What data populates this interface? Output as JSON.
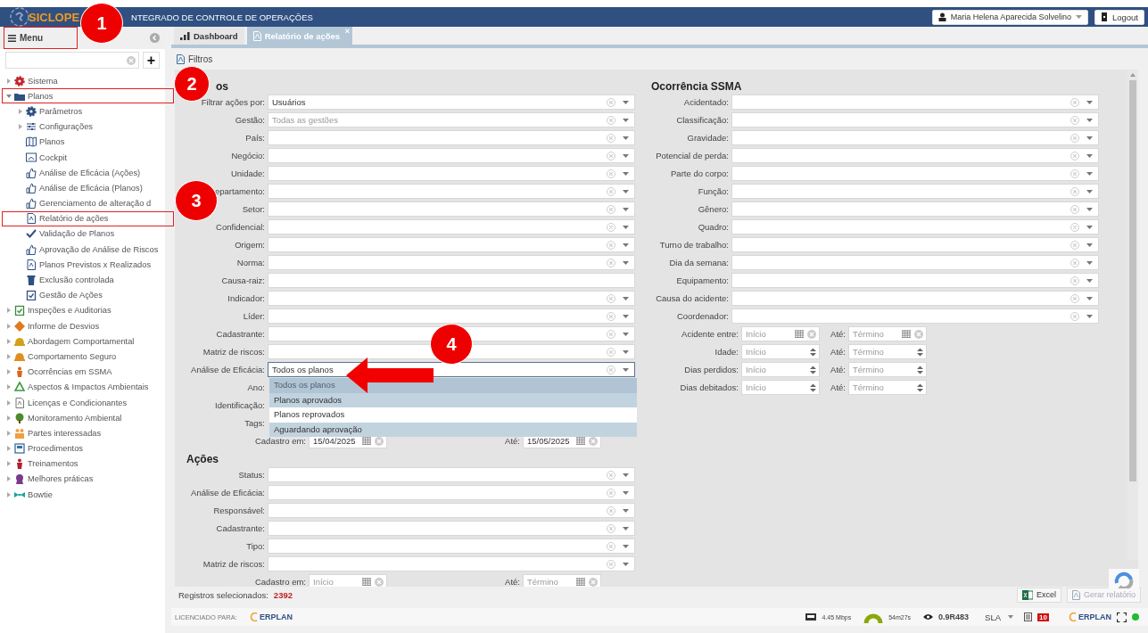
{
  "header": {
    "logo": "SICLOPE",
    "title": "NTEGRADO DE CONTROLE DE OPERAÇÕES",
    "user": "Maria Helena Aparecida Solvelino",
    "logout": "Logout"
  },
  "sidebar": {
    "menu": {
      "label": "Menu",
      "annotated": true
    },
    "add_button": "+",
    "items": [
      {
        "label": "Sistema",
        "kind": "group",
        "expanded": false,
        "annotated": false
      },
      {
        "label": "Planos",
        "kind": "group",
        "expanded": true,
        "annotated": true,
        "children": [
          {
            "label": "Parâmetros",
            "kind": "group",
            "expanded": false,
            "annotated": false
          },
          {
            "label": "Configurações",
            "kind": "group",
            "expanded": false,
            "annotated": false
          },
          {
            "label": "Planos",
            "kind": "leaf",
            "annotated": false
          },
          {
            "label": "Cockpit",
            "kind": "leaf",
            "annotated": false
          },
          {
            "label": "Análise de Eficácia (Ações)",
            "kind": "leaf",
            "annotated": false
          },
          {
            "label": "Análise de Eficácia (Planos)",
            "kind": "leaf",
            "annotated": false
          },
          {
            "label": "Gerenciamento de alteração d",
            "kind": "leaf",
            "annotated": false
          },
          {
            "label": "Relatório de ações",
            "kind": "leaf",
            "annotated": true
          },
          {
            "label": "Validação de Planos",
            "kind": "leaf",
            "annotated": false
          },
          {
            "label": "Aprovação de Análise de Riscos",
            "kind": "leaf",
            "annotated": false
          },
          {
            "label": "Planos Previstos x Realizados",
            "kind": "leaf",
            "annotated": false
          },
          {
            "label": "Exclusão controlada",
            "kind": "leaf",
            "annotated": false
          },
          {
            "label": "Gestão de Ações",
            "kind": "leaf",
            "annotated": false
          }
        ]
      },
      {
        "label": "Inspeções e Auditorias",
        "kind": "group",
        "expanded": false,
        "annotated": false
      },
      {
        "label": "Informe de Desvios",
        "kind": "group",
        "expanded": false,
        "annotated": false
      },
      {
        "label": "Abordagem Comportamental",
        "kind": "group",
        "expanded": false,
        "annotated": false
      },
      {
        "label": "Comportamento Seguro",
        "kind": "group",
        "expanded": false,
        "annotated": false
      },
      {
        "label": "Ocorrências em SSMA",
        "kind": "group",
        "expanded": false,
        "annotated": false
      },
      {
        "label": "Aspectos & Impactos Ambientais",
        "kind": "group",
        "expanded": false,
        "annotated": false
      },
      {
        "label": "Licenças e Condicionantes",
        "kind": "group",
        "expanded": false,
        "annotated": false
      },
      {
        "label": "Monitoramento Ambiental",
        "kind": "group",
        "expanded": false,
        "annotated": false
      },
      {
        "label": "Partes interessadas",
        "kind": "group",
        "expanded": false,
        "annotated": false
      },
      {
        "label": "Procedimentos",
        "kind": "group",
        "expanded": false,
        "annotated": false
      },
      {
        "label": "Treinamentos",
        "kind": "group",
        "expanded": false,
        "annotated": false
      },
      {
        "label": "Melhores práticas",
        "kind": "group",
        "expanded": false,
        "annotated": false
      },
      {
        "label": "Bowtie",
        "kind": "group",
        "expanded": false,
        "annotated": false
      }
    ]
  },
  "tabs": [
    {
      "label": "Dashboard",
      "selected": false
    },
    {
      "label": "Relatório de ações",
      "selected": true,
      "close": "×"
    }
  ],
  "filters_link": "Filtros",
  "left_sections": [
    {
      "title": "os",
      "fields": [
        {
          "label": "Filtrar ações por:",
          "kind": "select",
          "value": "Usuários"
        },
        {
          "label": "Gestão:",
          "kind": "select",
          "placeholder": "Todas as gestões"
        },
        {
          "label": "País:",
          "kind": "select"
        },
        {
          "label": "Negócio:",
          "kind": "select"
        },
        {
          "label": "Unidade:",
          "kind": "select"
        },
        {
          "label": "epartamento:",
          "kind": "select"
        },
        {
          "label": "Setor:",
          "kind": "select"
        },
        {
          "label": "Confidencial:",
          "kind": "select"
        },
        {
          "label": "Origem:",
          "kind": "select"
        },
        {
          "label": "Norma:",
          "kind": "select"
        },
        {
          "label": "Causa-raiz:",
          "kind": "text"
        },
        {
          "label": "Indicador:",
          "kind": "select"
        },
        {
          "label": "Líder:",
          "kind": "select"
        },
        {
          "label": "Cadastrante:",
          "kind": "select"
        },
        {
          "label": "Matriz de riscos:",
          "kind": "select"
        },
        {
          "label": "Análise de Eficácia:",
          "kind": "select-open",
          "value": "Todos os planos"
        },
        {
          "label": "Ano:",
          "kind": "covered"
        },
        {
          "label": "Identificação:",
          "kind": "covered"
        },
        {
          "label": "Tags:",
          "kind": "covered"
        },
        {
          "label": "Cadastro em:",
          "kind": "date-range",
          "from": {
            "value": "15/04/2025"
          },
          "to_label": "Até:",
          "to": {
            "value": "15/05/2025"
          }
        }
      ]
    },
    {
      "title": "Ações",
      "fields": [
        {
          "label": "Status:",
          "kind": "select"
        },
        {
          "label": "Análise de Eficácia:",
          "kind": "select"
        },
        {
          "label": "Responsável:",
          "kind": "select"
        },
        {
          "label": "Cadastrante:",
          "kind": "select"
        },
        {
          "label": "Tipo:",
          "kind": "select"
        },
        {
          "label": "Matriz de riscos:",
          "kind": "select"
        },
        {
          "label": "Cadastro em:",
          "kind": "date-range",
          "from": {
            "placeholder": "Início"
          },
          "to_label": "Até:",
          "to": {
            "placeholder": "Término"
          }
        }
      ]
    }
  ],
  "dropdown": {
    "options": [
      {
        "label": "Todos os planos",
        "selected": true,
        "highlighted": false
      },
      {
        "label": "Planos aprovados",
        "selected": false,
        "highlighted": true
      },
      {
        "label": "Planos reprovados",
        "selected": false,
        "highlighted": false
      },
      {
        "label": "Aguardando aprovação",
        "selected": false,
        "highlighted": true
      }
    ]
  },
  "right_section": {
    "title": "Ocorrência SSMA",
    "fields": [
      {
        "label": "Acidentado:",
        "kind": "select"
      },
      {
        "label": "Classificação:",
        "kind": "select"
      },
      {
        "label": "Gravidade:",
        "kind": "select"
      },
      {
        "label": "Potencial de perda:",
        "kind": "select"
      },
      {
        "label": "Parte do corpo:",
        "kind": "select"
      },
      {
        "label": "Função:",
        "kind": "select"
      },
      {
        "label": "Gênero:",
        "kind": "select"
      },
      {
        "label": "Quadro:",
        "kind": "select"
      },
      {
        "label": "Turno de trabalho:",
        "kind": "select"
      },
      {
        "label": "Dia da semana:",
        "kind": "select"
      },
      {
        "label": "Equipamento:",
        "kind": "select"
      },
      {
        "label": "Causa do acidente:",
        "kind": "select"
      },
      {
        "label": "Coordenador:",
        "kind": "select"
      },
      {
        "label": "Acidente entre:",
        "kind": "date-range",
        "from": {
          "placeholder": "Início"
        },
        "to_label": "Até:",
        "to": {
          "placeholder": "Término"
        }
      },
      {
        "label": "Idade:",
        "kind": "number-range",
        "from": {
          "placeholder": "Início"
        },
        "to_label": "Até:",
        "to": {
          "placeholder": "Término"
        }
      },
      {
        "label": "Dias perdidos:",
        "kind": "number-range",
        "from": {
          "placeholder": "Início"
        },
        "to_label": "Até:",
        "to": {
          "placeholder": "Término"
        }
      },
      {
        "label": "Dias debitados:",
        "kind": "number-range",
        "from": {
          "placeholder": "Início"
        },
        "to_label": "Até:",
        "to": {
          "placeholder": "Término"
        }
      }
    ]
  },
  "footer": {
    "records_label": "Registros selecionados:",
    "records_count": "2392",
    "buttons": [
      {
        "label": "Excel",
        "disabled": false
      },
      {
        "label": "Gerar relatório",
        "disabled": true
      }
    ]
  },
  "status_bar": {
    "licensed_label": "LICENCIADO PARA:",
    "license_logo": "ERPLAN",
    "speed": "4.45 Mbps",
    "session": "54m27s",
    "version": "0.9R483",
    "sla": "SLA",
    "badge": "10",
    "logo": "ERPLAN"
  },
  "annotations": [
    {
      "kind": "marker",
      "label": "1"
    },
    {
      "kind": "marker",
      "label": "2"
    },
    {
      "kind": "marker",
      "label": "3"
    },
    {
      "kind": "marker",
      "label": "4"
    },
    {
      "kind": "arrow"
    }
  ]
}
